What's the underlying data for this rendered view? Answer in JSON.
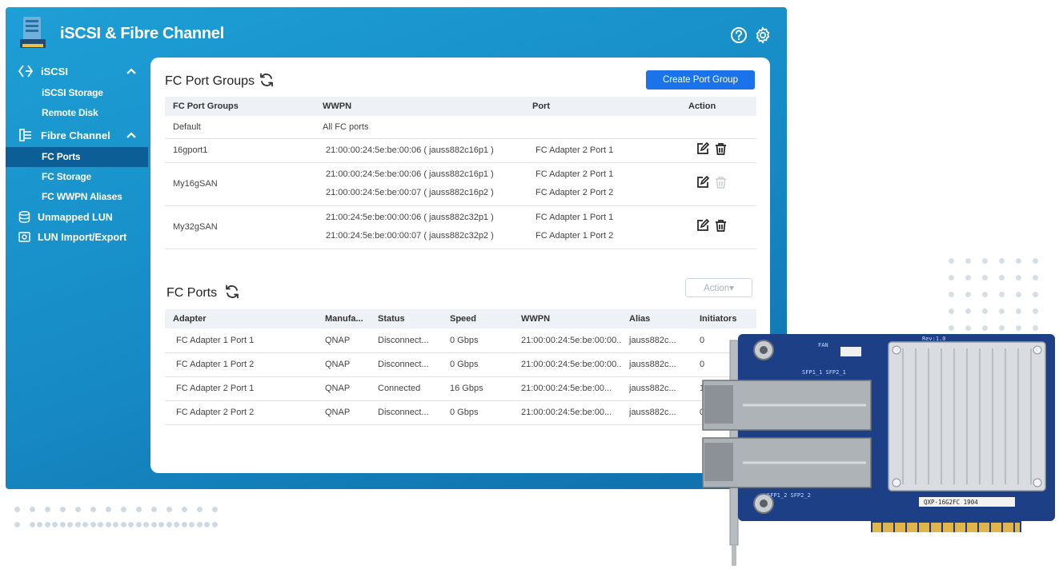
{
  "app": {
    "title": "iSCSI & Fibre Channel"
  },
  "sidebar": {
    "groups": [
      {
        "label": "iSCSI",
        "items": [
          "iSCSI Storage",
          "Remote Disk"
        ]
      },
      {
        "label": "Fibre Channel",
        "items": [
          "FC Ports",
          "FC Storage",
          "FC WWPN Aliases"
        ]
      }
    ],
    "active": "FC Ports",
    "top_items": [
      "Unmapped LUN",
      "LUN Import/Export"
    ]
  },
  "port_groups": {
    "title": "FC Port Groups",
    "create_button": "Create Port Group",
    "headers": [
      "FC Port Groups",
      "WWPN",
      "Port",
      "Action"
    ],
    "rows": [
      {
        "name": "Default",
        "wwpn": [
          "All FC ports"
        ],
        "port": [
          ""
        ],
        "actions": false,
        "delete_enabled": false
      },
      {
        "name": "16gport1",
        "wwpn": [
          "21:00:00:24:5e:be:00:06 ( jauss882c16p1 )"
        ],
        "port": [
          "FC Adapter 2 Port 1"
        ],
        "actions": true,
        "delete_enabled": true
      },
      {
        "name": "My16gSAN",
        "wwpn": [
          "21:00:00:24:5e:be:00:06 ( jauss882c16p1 )",
          "21:00:00:24:5e:be:00:07 ( jauss882c16p2 )"
        ],
        "port": [
          "FC Adapter 2 Port 1",
          "FC Adapter 2 Port 2"
        ],
        "actions": true,
        "delete_enabled": false
      },
      {
        "name": "My32gSAN",
        "wwpn": [
          "21:00:24:5e:be:00:00:06 ( jauss882c32p1 )",
          "21:00:24:5e:be:00:00:07 ( jauss882c32p2 )"
        ],
        "port": [
          "FC Adapter 1 Port 1",
          "FC Adapter 1 Port 2"
        ],
        "actions": true,
        "delete_enabled": true
      }
    ]
  },
  "ports": {
    "title": "FC Ports",
    "action_button": "Action▾",
    "headers": [
      "Adapter",
      "Manufa...",
      "Status",
      "Speed",
      "WWPN",
      "Alias",
      "Initiators"
    ],
    "rows": [
      [
        "FC Adapter 1 Port 1",
        "QNAP",
        "Disconnect...",
        "0 Gbps",
        "21:00:00:24:5e:be:00:00...",
        "jauss882c...",
        "0"
      ],
      [
        "FC Adapter 1 Port 2",
        "QNAP",
        "Disconnect...",
        "0 Gbps",
        "21:00:00:24:5e:be:00:00...",
        "jauss882c...",
        "0"
      ],
      [
        "FC Adapter 2 Port 1",
        "QNAP",
        "Connected",
        "16 Gbps",
        "21:00:00:24:5e:be:00...",
        "jauss882c...",
        "1"
      ],
      [
        "FC Adapter 2 Port 2",
        "QNAP",
        "Disconnect...",
        "0 Gbps",
        "21:00:00:24:5e:be:00...",
        "jauss882c...",
        "0"
      ]
    ]
  },
  "card_labels": {
    "rev": "Rev:1.0",
    "fan": "FAN",
    "sfp_top": "SFP1_1 SFP2_1",
    "sfp_bottom": "SFP1_2 SFP2_2",
    "sticker": "QXP-16G2FC 1904"
  },
  "colors": {
    "window": "#1689c4",
    "active_nav": "#0c5f96",
    "primary": "#1a73e8",
    "pcb": "#1c3f86"
  }
}
